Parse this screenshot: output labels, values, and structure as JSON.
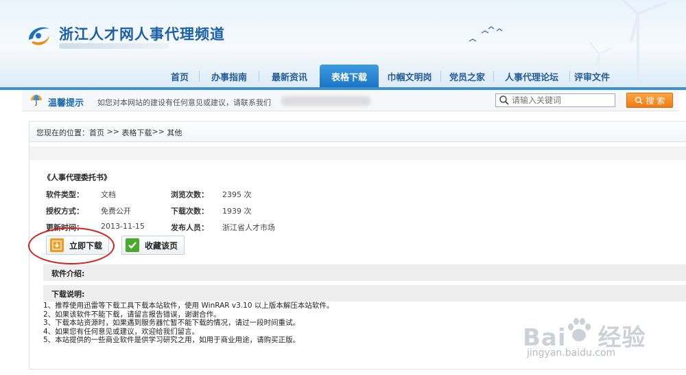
{
  "header": {
    "site_title": "浙江人才网人事代理频道"
  },
  "nav": {
    "items": [
      {
        "label": "首页",
        "active": false
      },
      {
        "label": "办事指南",
        "active": false
      },
      {
        "label": "最新资讯",
        "active": false
      },
      {
        "label": "表格下载",
        "active": true
      },
      {
        "label": "巾帼文明岗",
        "active": false
      },
      {
        "label": "党员之家",
        "active": false
      },
      {
        "label": "人事代理论坛",
        "active": false
      },
      {
        "label": "评审文件",
        "active": false
      }
    ]
  },
  "tips": {
    "title": "温馨提示",
    "text": "如您对本网站的建设有任何意见或建议，请联系我们",
    "search_placeholder": "请输入关键词",
    "search_button": "搜 索"
  },
  "breadcrumb": {
    "prefix": "您现在的位置：",
    "items": [
      "首页",
      " >> ",
      "表格下载",
      ">> ",
      "其他"
    ]
  },
  "document": {
    "title": "《人事代理委托书》",
    "fields": [
      {
        "label": "软件类型：",
        "value": "文档"
      },
      {
        "label": "浏览次数：",
        "value": "2395 次"
      },
      {
        "label": "授权方式：",
        "value": "免费公开"
      },
      {
        "label": "下载次数：",
        "value": "1939 次"
      },
      {
        "label": "更新时间：",
        "value": "2013-11-15"
      },
      {
        "label": "发布人员：",
        "value": "浙江省人才市场"
      }
    ],
    "download_button": "立即下载",
    "favorite_button": "收藏该页"
  },
  "sections": {
    "intro_label": "软件介绍:",
    "notes_label": "下载说明:",
    "notes": [
      "1、推荐使用迅雷等下载工具下载本站软件，使用 WinRAR v3.10 以上版本解压本站软件。",
      "2、如果该软件不能下载，请留言报告错误，谢谢合作。",
      "3、下载本站资源时，如果遇到服务器忙暂不能下载的情况，请过一段时间重试。",
      "4、如果您有任何意见或建议，欢迎给我们留言。",
      "5、本站提供的一些商业软件是供学习研究之用，如用于商业用途，请购买正版。"
    ]
  },
  "watermark": {
    "brand_left": "Bai",
    "brand_right": "经验",
    "url": "jingyan.baidu.com"
  }
}
